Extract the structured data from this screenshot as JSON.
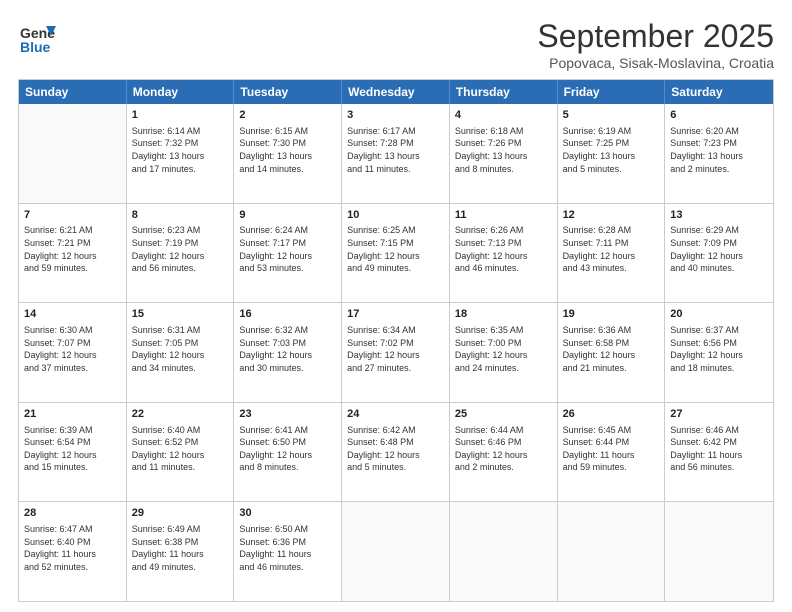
{
  "header": {
    "logo_line1": "General",
    "logo_line2": "Blue",
    "month": "September 2025",
    "location": "Popovaca, Sisak-Moslavina, Croatia"
  },
  "days_of_week": [
    "Sunday",
    "Monday",
    "Tuesday",
    "Wednesday",
    "Thursday",
    "Friday",
    "Saturday"
  ],
  "weeks": [
    [
      {
        "day": "",
        "empty": true
      },
      {
        "day": "1",
        "sunrise": "6:14 AM",
        "sunset": "7:32 PM",
        "daylight": "13 hours and 17 minutes."
      },
      {
        "day": "2",
        "sunrise": "6:15 AM",
        "sunset": "7:30 PM",
        "daylight": "13 hours and 14 minutes."
      },
      {
        "day": "3",
        "sunrise": "6:17 AM",
        "sunset": "7:28 PM",
        "daylight": "13 hours and 11 minutes."
      },
      {
        "day": "4",
        "sunrise": "6:18 AM",
        "sunset": "7:26 PM",
        "daylight": "13 hours and 8 minutes."
      },
      {
        "day": "5",
        "sunrise": "6:19 AM",
        "sunset": "7:25 PM",
        "daylight": "13 hours and 5 minutes."
      },
      {
        "day": "6",
        "sunrise": "6:20 AM",
        "sunset": "7:23 PM",
        "daylight": "13 hours and 2 minutes."
      }
    ],
    [
      {
        "day": "7",
        "sunrise": "6:21 AM",
        "sunset": "7:21 PM",
        "daylight": "12 hours and 59 minutes."
      },
      {
        "day": "8",
        "sunrise": "6:23 AM",
        "sunset": "7:19 PM",
        "daylight": "12 hours and 56 minutes."
      },
      {
        "day": "9",
        "sunrise": "6:24 AM",
        "sunset": "7:17 PM",
        "daylight": "12 hours and 53 minutes."
      },
      {
        "day": "10",
        "sunrise": "6:25 AM",
        "sunset": "7:15 PM",
        "daylight": "12 hours and 49 minutes."
      },
      {
        "day": "11",
        "sunrise": "6:26 AM",
        "sunset": "7:13 PM",
        "daylight": "12 hours and 46 minutes."
      },
      {
        "day": "12",
        "sunrise": "6:28 AM",
        "sunset": "7:11 PM",
        "daylight": "12 hours and 43 minutes."
      },
      {
        "day": "13",
        "sunrise": "6:29 AM",
        "sunset": "7:09 PM",
        "daylight": "12 hours and 40 minutes."
      }
    ],
    [
      {
        "day": "14",
        "sunrise": "6:30 AM",
        "sunset": "7:07 PM",
        "daylight": "12 hours and 37 minutes."
      },
      {
        "day": "15",
        "sunrise": "6:31 AM",
        "sunset": "7:05 PM",
        "daylight": "12 hours and 34 minutes."
      },
      {
        "day": "16",
        "sunrise": "6:32 AM",
        "sunset": "7:03 PM",
        "daylight": "12 hours and 30 minutes."
      },
      {
        "day": "17",
        "sunrise": "6:34 AM",
        "sunset": "7:02 PM",
        "daylight": "12 hours and 27 minutes."
      },
      {
        "day": "18",
        "sunrise": "6:35 AM",
        "sunset": "7:00 PM",
        "daylight": "12 hours and 24 minutes."
      },
      {
        "day": "19",
        "sunrise": "6:36 AM",
        "sunset": "6:58 PM",
        "daylight": "12 hours and 21 minutes."
      },
      {
        "day": "20",
        "sunrise": "6:37 AM",
        "sunset": "6:56 PM",
        "daylight": "12 hours and 18 minutes."
      }
    ],
    [
      {
        "day": "21",
        "sunrise": "6:39 AM",
        "sunset": "6:54 PM",
        "daylight": "12 hours and 15 minutes."
      },
      {
        "day": "22",
        "sunrise": "6:40 AM",
        "sunset": "6:52 PM",
        "daylight": "12 hours and 11 minutes."
      },
      {
        "day": "23",
        "sunrise": "6:41 AM",
        "sunset": "6:50 PM",
        "daylight": "12 hours and 8 minutes."
      },
      {
        "day": "24",
        "sunrise": "6:42 AM",
        "sunset": "6:48 PM",
        "daylight": "12 hours and 5 minutes."
      },
      {
        "day": "25",
        "sunrise": "6:44 AM",
        "sunset": "6:46 PM",
        "daylight": "12 hours and 2 minutes."
      },
      {
        "day": "26",
        "sunrise": "6:45 AM",
        "sunset": "6:44 PM",
        "daylight": "11 hours and 59 minutes."
      },
      {
        "day": "27",
        "sunrise": "6:46 AM",
        "sunset": "6:42 PM",
        "daylight": "11 hours and 56 minutes."
      }
    ],
    [
      {
        "day": "28",
        "sunrise": "6:47 AM",
        "sunset": "6:40 PM",
        "daylight": "11 hours and 52 minutes."
      },
      {
        "day": "29",
        "sunrise": "6:49 AM",
        "sunset": "6:38 PM",
        "daylight": "11 hours and 49 minutes."
      },
      {
        "day": "30",
        "sunrise": "6:50 AM",
        "sunset": "6:36 PM",
        "daylight": "11 hours and 46 minutes."
      },
      {
        "day": "",
        "empty": true
      },
      {
        "day": "",
        "empty": true
      },
      {
        "day": "",
        "empty": true
      },
      {
        "day": "",
        "empty": true
      }
    ]
  ]
}
